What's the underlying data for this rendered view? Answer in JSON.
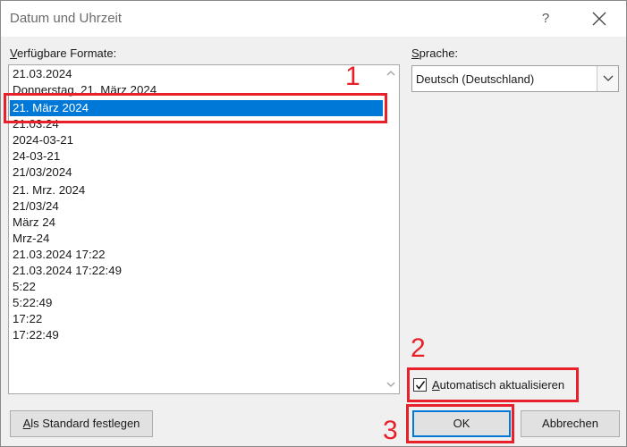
{
  "window": {
    "title": "Datum und Uhrzeit",
    "help_label": "?"
  },
  "formats": {
    "label_accel": "V",
    "label_rest": "erfügbare Formate:",
    "items": [
      "21.03.2024",
      "Donnerstag, 21. März 2024",
      "21. März 2024",
      "21.03.24",
      "2024-03-21",
      "24-03-21",
      "21/03/2024",
      "21. Mrz. 2024",
      "21/03/24",
      "März 24",
      "Mrz-24",
      "21.03.2024 17:22",
      "21.03.2024 17:22:49",
      "5:22",
      "5:22:49",
      "17:22",
      "17:22:49"
    ],
    "selected_index": 2
  },
  "language": {
    "label_accel": "S",
    "label_rest": "prache:",
    "value": "Deutsch (Deutschland)"
  },
  "auto_update": {
    "checked": true,
    "label_accel": "A",
    "label_rest": "utomatisch aktualisieren"
  },
  "buttons": {
    "set_default_accel": "A",
    "set_default_rest": "ls Standard festlegen",
    "ok": "OK",
    "cancel": "Abbrechen"
  },
  "annotations": {
    "marker1": "1",
    "marker2": "2",
    "marker3": "3",
    "color": "#e8202a"
  },
  "colors": {
    "selection": "#0078d7",
    "dialog_bg": "#f0f0f0"
  }
}
